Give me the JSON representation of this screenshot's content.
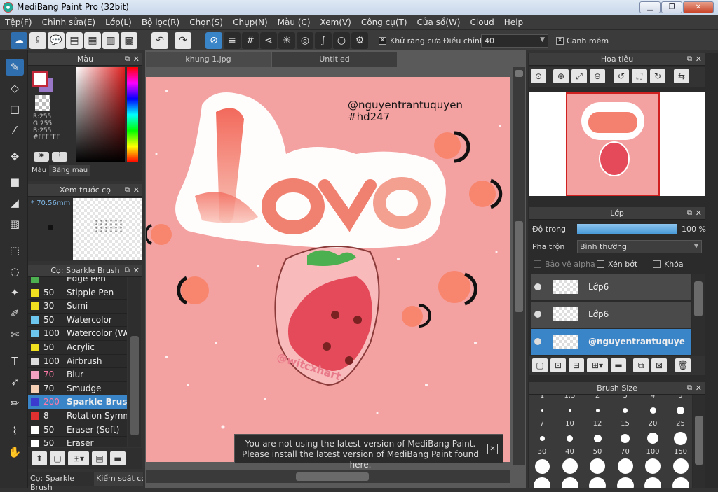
{
  "window": {
    "title": "MediBang Paint Pro (32bit)"
  },
  "menu": [
    "Tệp(F)",
    "Chỉnh sửa(E)",
    "Lớp(L)",
    "Bộ lọc(R)",
    "Chọn(S)",
    "Chụp(N)",
    "Màu (C)",
    "Xem(V)",
    "Công cụ(T)",
    "Cửa sổ(W)",
    "Cloud",
    "Help"
  ],
  "toolbar": {
    "antialias_label": "Khử răng cưa",
    "adjust_label": "Điều chỉnh",
    "adjust_value": "40",
    "soft_edge_label": "Cạnh mềm"
  },
  "color_panel": {
    "title": "Màu",
    "rgb": [
      "R:255",
      "G:255",
      "B:255"
    ],
    "hex": "#FFFFFF",
    "tabs": [
      "Màu",
      "Bảng màu"
    ],
    "fg_color": "#ffffff",
    "accent": "#c0283a"
  },
  "preview_panel": {
    "title": "Xem trước cọ",
    "size": "70.56mm"
  },
  "brush_panel": {
    "title": "Cọ: Sparkle Brush",
    "items": [
      {
        "num": "",
        "name": "Edge Pen",
        "color": "#4caf50"
      },
      {
        "num": "50",
        "name": "Stipple Pen",
        "color": "#f0e020"
      },
      {
        "num": "30",
        "name": "Sumi",
        "color": "#f0e020"
      },
      {
        "num": "50",
        "name": "Watercolor",
        "color": "#6cc6ee"
      },
      {
        "num": "100",
        "name": "Watercolor (We",
        "color": "#6cc6ee"
      },
      {
        "num": "50",
        "name": "Acrylic",
        "color": "#f0e020"
      },
      {
        "num": "100",
        "name": "Airbrush",
        "color": "#ddd"
      },
      {
        "num": "70",
        "name": "Blur",
        "color": "#f0a0c0"
      },
      {
        "num": "70",
        "name": "Smudge",
        "color": "#f5d0b5"
      },
      {
        "num": "200",
        "name": "Sparkle Brus",
        "color": "#3b3bd0"
      },
      {
        "num": "8",
        "name": "Rotation Symme",
        "color": "#e03030"
      },
      {
        "num": "50",
        "name": "Eraser (Soft)",
        "color": "#fff"
      },
      {
        "num": "50",
        "name": "Eraser",
        "color": "#fff"
      }
    ],
    "bottom_tabs": [
      "Cọ: Sparkle Brush",
      "Kiểm soát cọ"
    ]
  },
  "doc_tabs": [
    "khung 1.jpg",
    "Untitled"
  ],
  "canvas": {
    "handle": "@nguyentrantuquyen",
    "tag": "#hd247",
    "word": "Love",
    "watermark": "@witcxhart"
  },
  "update_notice": {
    "line1": "You are not using the latest version of MediBang Paint.",
    "line2": "Please install the latest version of MediBang Paint found here."
  },
  "navigator": {
    "title": "Hoa tiêu"
  },
  "layers": {
    "title": "Lớp",
    "opacity_label": "Độ trong",
    "opacity_value": "100 %",
    "blend_label": "Pha trộn",
    "blend_value": "Bình thường",
    "protect_alpha": "Bảo vệ alpha",
    "clip": "Xén bớt",
    "lock": "Khóa",
    "items": [
      {
        "name": "Lớp6"
      },
      {
        "name": "Lớp6"
      },
      {
        "name": "@nguyentrantuquye"
      }
    ]
  },
  "brush_size": {
    "title": "Brush Size",
    "row0": [
      "1",
      "1.5",
      "2",
      "3",
      "4",
      "5"
    ],
    "row1": [
      "7",
      "10",
      "12",
      "15",
      "20",
      "25"
    ],
    "row2": [
      "30",
      "40",
      "50",
      "70",
      "100",
      "150"
    ]
  }
}
